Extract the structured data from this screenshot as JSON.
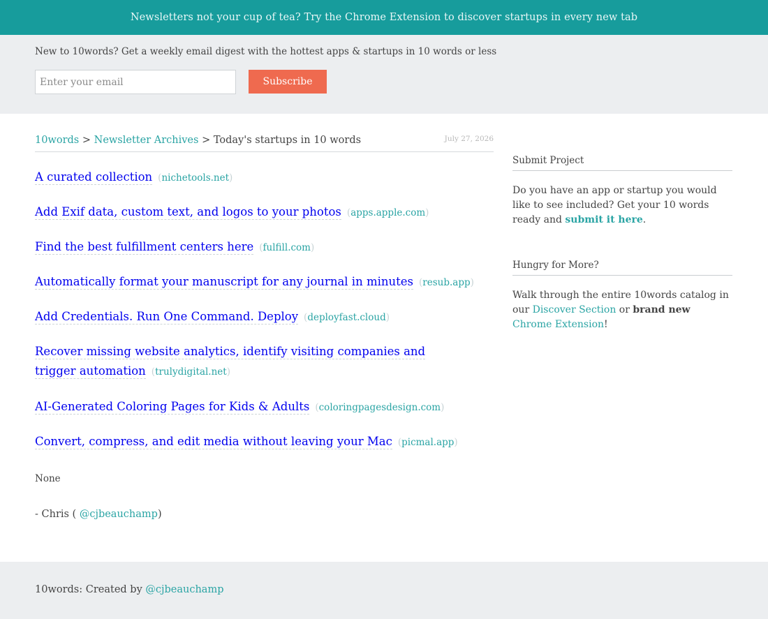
{
  "banner": {
    "text": "Newsletters not your cup of tea? Try the Chrome Extension to discover startups in every new tab"
  },
  "signup": {
    "prompt": "New to 10words? Get a weekly email digest with the hottest apps & startups in 10 words or less",
    "email_placeholder": "Enter your email",
    "subscribe_label": "Subscribe"
  },
  "breadcrumb": {
    "home": "10words",
    "sep1": " > ",
    "archives": "Newsletter Archives",
    "sep2": " > ",
    "current": "Today's startups in 10 words"
  },
  "post_date": "July 27, 2026",
  "items": [
    {
      "text": "A curated collection",
      "domain": "nichetools.net"
    },
    {
      "text": "Add Exif data, custom text, and logos to your photos",
      "domain": "apps.apple.com"
    },
    {
      "text": "Find the best fulfillment centers here",
      "domain": "fulfill.com"
    },
    {
      "text": "Automatically format your manuscript for any journal in minutes",
      "domain": "resub.app"
    },
    {
      "text": "Add Credentials. Run One Command. Deploy",
      "domain": "deployfast.cloud"
    },
    {
      "text": "Recover missing website analytics, identify visiting companies and trigger automation",
      "domain": "trulydigital.net"
    },
    {
      "text": "AI-Generated Coloring Pages for Kids & Adults",
      "domain": "coloringpagesdesign.com"
    },
    {
      "text": "Convert, compress, and edit media without leaving your Mac",
      "domain": "picmal.app"
    }
  ],
  "note": "None",
  "signoff": {
    "prefix": "- Chris ( ",
    "handle": "@cjbeauchamp",
    "suffix": ")"
  },
  "sidebar": {
    "submit_heading": "Submit Project",
    "submit_text": "Do you have an app or startup you would like to see included? Get your 10 words ready and ",
    "submit_link": "submit it here",
    "submit_end": ".",
    "more_heading": "Hungry for More?",
    "more_text": "Walk through the entire 10words catalog in our ",
    "discover_link": "Discover Section",
    "more_mid": " or ",
    "more_strong": "brand new",
    "chrome_link": "Chrome Extension",
    "more_end": "!"
  },
  "footer": {
    "prefix": "10words: Created by ",
    "handle": "@cjbeauchamp"
  },
  "colors": {
    "accent": "#179c9c",
    "link": "#2aa4a4",
    "subscribe": "#ef6a4f",
    "panel": "#eceef0"
  }
}
